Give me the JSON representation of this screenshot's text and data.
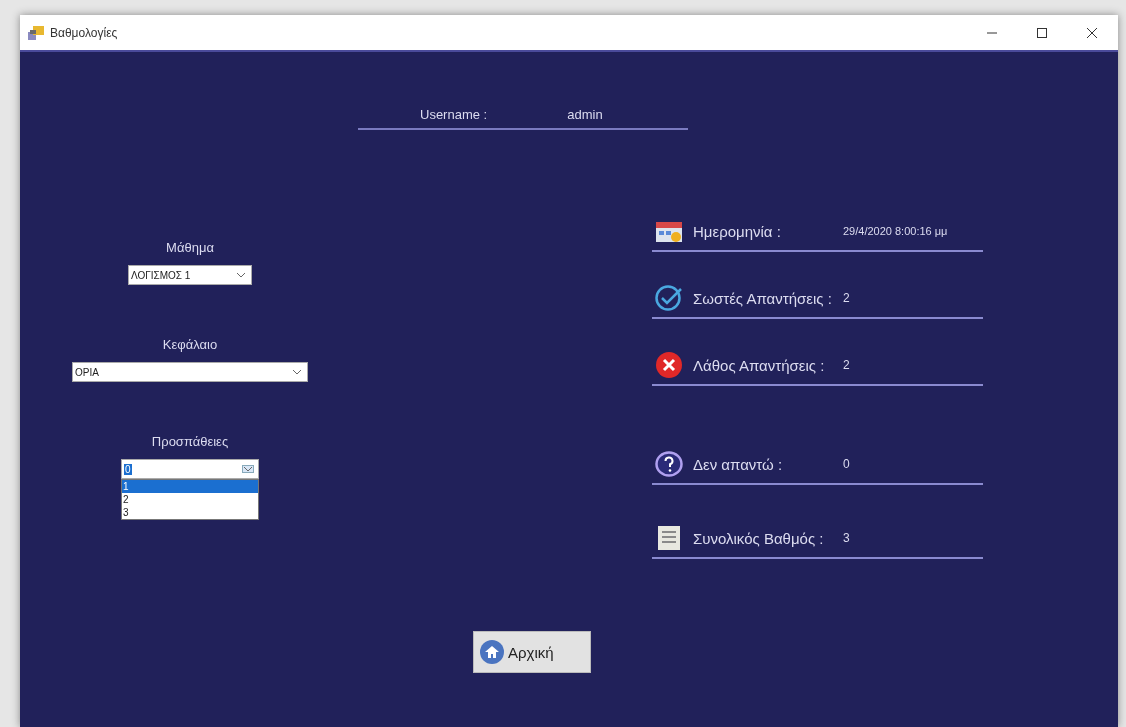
{
  "window": {
    "title": "Βαθμολογίες"
  },
  "user": {
    "label": "Username :",
    "value": "admin"
  },
  "fields": [
    {
      "label": "Μάθημα",
      "value": "ΛΟΓΙΣΜΟΣ 1",
      "open": false
    },
    {
      "label": "Κεφάλαιο",
      "value": "ΟΡΙΑ",
      "open": false
    },
    {
      "label": "Προσπάθειες",
      "value": "0",
      "open": true,
      "options": [
        {
          "label": "1",
          "selected": true
        },
        {
          "label": "2",
          "selected": false
        },
        {
          "label": "3",
          "selected": false
        }
      ]
    }
  ],
  "stats": [
    {
      "kind": "date",
      "label": "Ημερομηνία :",
      "value": "29/4/2020 8:00:16 μμ"
    },
    {
      "kind": "correct",
      "label": "Σωστές Απαντήσεις :",
      "value": "2"
    },
    {
      "kind": "wrong",
      "label": "Λάθος Απαντήσεις :",
      "value": "2"
    },
    {
      "kind": "unanswered",
      "label": "Δεν απαντώ :",
      "value": "0"
    },
    {
      "kind": "total",
      "label": "Συνολικός Βαθμός :",
      "value": "3"
    }
  ],
  "home_button": {
    "label": "Αρχική"
  }
}
